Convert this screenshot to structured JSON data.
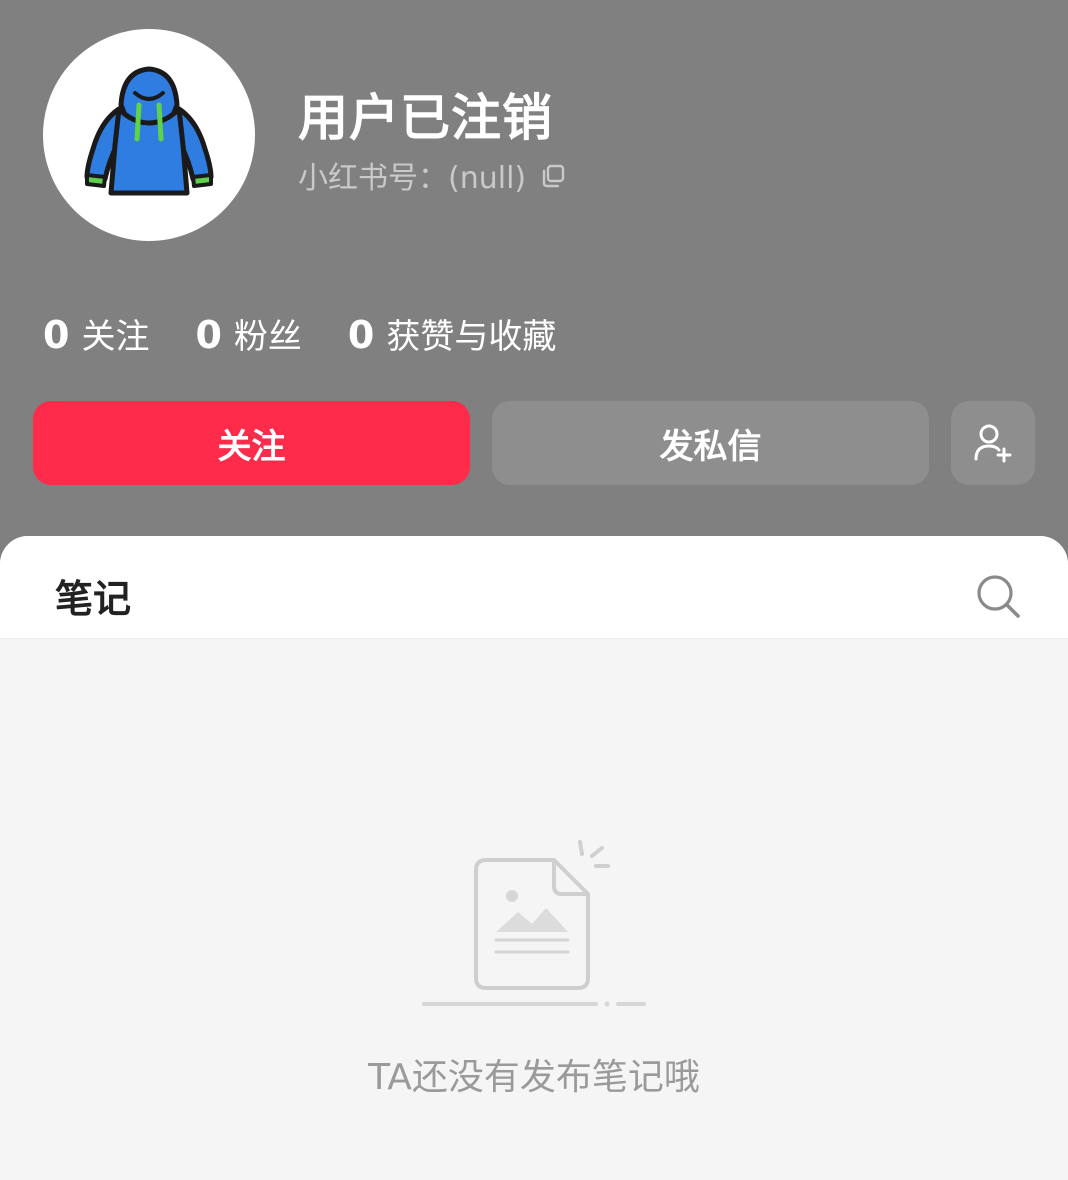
{
  "profile": {
    "username": "用户已注销",
    "id_label": "小红书号：",
    "id_value": "(null)",
    "avatar_icon": "hoodie-avatar-icon"
  },
  "stats": [
    {
      "value": "0",
      "label": "关注"
    },
    {
      "value": "0",
      "label": "粉丝"
    },
    {
      "value": "0",
      "label": "获赞与收藏"
    }
  ],
  "actions": {
    "follow_label": "关注",
    "message_label": "发私信",
    "add_user_icon": "add-user-icon"
  },
  "tabs": {
    "notes_label": "笔记",
    "search_icon": "search-icon"
  },
  "empty_state": {
    "text": "TA还没有发布笔记哦",
    "icon": "empty-document-icon"
  },
  "colors": {
    "header_bg": "#808080",
    "follow_button": "#fe2c4a",
    "secondary_button": "#8e8e8e",
    "panel_bg": "#f5f5f5"
  }
}
